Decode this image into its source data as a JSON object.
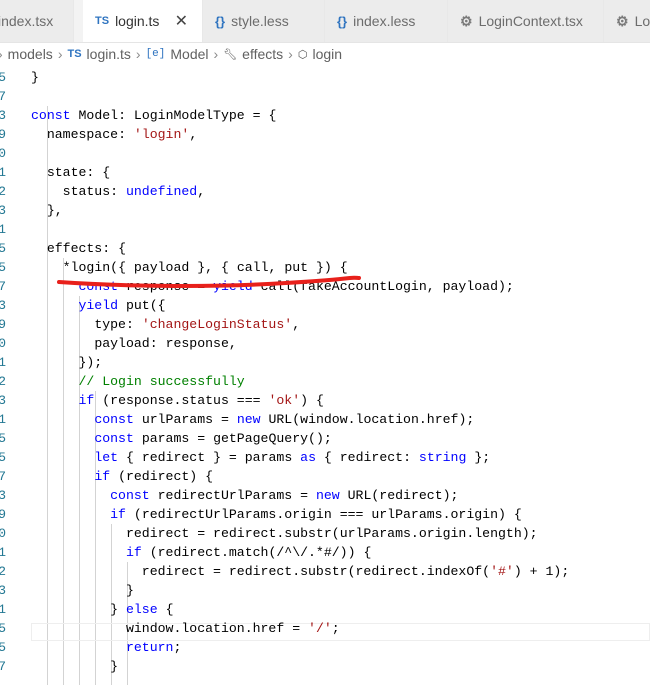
{
  "tabs": [
    {
      "label": "index.tsx",
      "icon": "",
      "active": false
    },
    {
      "label": "login.ts",
      "icon": "TS",
      "active": true,
      "close": "✕"
    },
    {
      "label": "style.less",
      "icon": "{}",
      "active": false
    },
    {
      "label": "index.less",
      "icon": "{}",
      "active": false
    },
    {
      "label": "LoginContext.tsx",
      "icon": "gear-icon",
      "active": false
    },
    {
      "label": "Lo",
      "icon": "gear-icon",
      "active": false
    }
  ],
  "breadcrumb": [
    {
      "label": "models",
      "icon": ""
    },
    {
      "label": "login.ts",
      "icon": "TS"
    },
    {
      "label": "Model",
      "icon": "[e]"
    },
    {
      "label": "effects",
      "icon": "wrench-icon"
    },
    {
      "label": "login",
      "icon": "cube-icon"
    }
  ],
  "code_lines": [
    {
      "num": "5",
      "text": "}"
    },
    {
      "num": "7",
      "text": ""
    },
    {
      "num": "3",
      "text": "const Model: LoginModelType = {"
    },
    {
      "num": "9",
      "text": "  namespace: 'login',"
    },
    {
      "num": "0",
      "text": ""
    },
    {
      "num": "1",
      "text": "  state: {"
    },
    {
      "num": "2",
      "text": "    status: undefined,"
    },
    {
      "num": "3",
      "text": "  },"
    },
    {
      "num": "1",
      "text": ""
    },
    {
      "num": "5",
      "text": "  effects: {"
    },
    {
      "num": "5",
      "text": "    *login({ payload }, { call, put }) {"
    },
    {
      "num": "7",
      "text": "      const response = yield call(fakeAccountLogin, payload);"
    },
    {
      "num": "3",
      "text": "      yield put({"
    },
    {
      "num": "9",
      "text": "        type: 'changeLoginStatus',"
    },
    {
      "num": "0",
      "text": "        payload: response,"
    },
    {
      "num": "1",
      "text": "      });"
    },
    {
      "num": "2",
      "text": "      // Login successfully"
    },
    {
      "num": "3",
      "text": "      if (response.status === 'ok') {"
    },
    {
      "num": "1",
      "text": "        const urlParams = new URL(window.location.href);"
    },
    {
      "num": "5",
      "text": "        const params = getPageQuery();"
    },
    {
      "num": "5",
      "text": "        let { redirect } = params as { redirect: string };"
    },
    {
      "num": "7",
      "text": "        if (redirect) {"
    },
    {
      "num": "3",
      "text": "          const redirectUrlParams = new URL(redirect);"
    },
    {
      "num": "9",
      "text": "          if (redirectUrlParams.origin === urlParams.origin) {"
    },
    {
      "num": "0",
      "text": "            redirect = redirect.substr(urlParams.origin.length);"
    },
    {
      "num": "1",
      "text": "            if (redirect.match(/^\\/.*#/)) {"
    },
    {
      "num": "2",
      "text": "              redirect = redirect.substr(redirect.indexOf('#') + 1);"
    },
    {
      "num": "3",
      "text": "            }"
    },
    {
      "num": "1",
      "text": "          } else {"
    },
    {
      "num": "5",
      "text": "            window.location.href = '/';"
    },
    {
      "num": "5",
      "text": "            return;"
    },
    {
      "num": "7",
      "text": "          }"
    }
  ],
  "colors": {
    "keyword": "#0000ff",
    "string": "#a31515",
    "comment": "#008000",
    "line_number": "#237893",
    "annotation_underline": "#e8201b"
  }
}
